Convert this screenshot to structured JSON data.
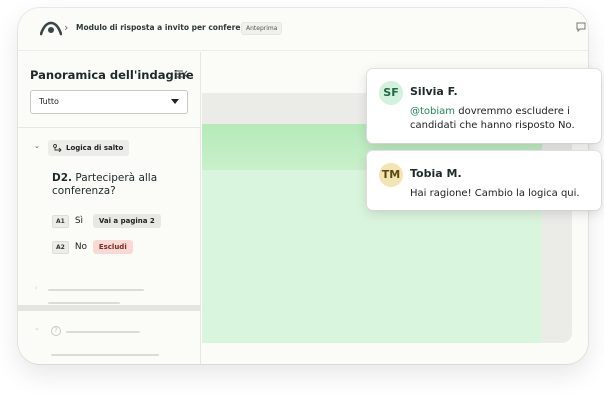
{
  "colors": {
    "accent_green": "#daf5dd",
    "mention": "#1f8a5a",
    "tag_exclude_bg": "#f9d9d3"
  },
  "header": {
    "logo_icon": "brand-logo-icon",
    "breadcrumb_title": "Modulo di risposta a invito per conferenze",
    "badge": "Anteprima"
  },
  "sidebar": {
    "title": "Panoramica dell'indagine",
    "filter_value": "Tutto",
    "logic_chip": "Logica di salto",
    "question_code": "D2.",
    "question_text": "Parteciperà alla conferenza?",
    "answers": [
      {
        "code": "A1",
        "label": "Sì",
        "action": "Vai a pagina 2"
      },
      {
        "code": "A2",
        "label": "No",
        "action": "Escludi"
      }
    ]
  },
  "comments": [
    {
      "initials": "SF",
      "name": "Silvia F.",
      "mention": "@tobiam",
      "text": " dovremmo escludere i candidati che hanno risposto No."
    },
    {
      "initials": "TM",
      "name": "Tobia M.",
      "text": "Hai ragione! Cambio la logica qui."
    }
  ]
}
